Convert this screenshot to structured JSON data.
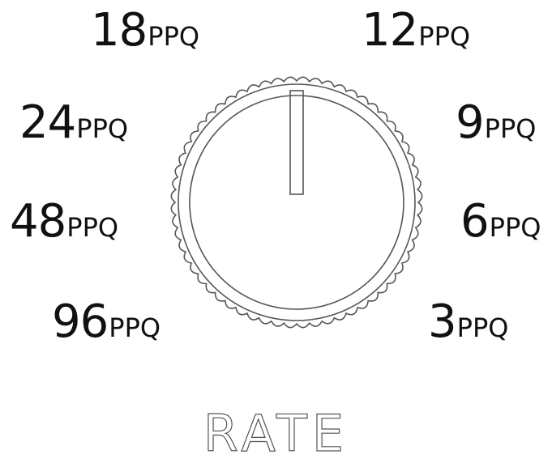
{
  "control": {
    "name": "RATE",
    "selected_index": 0
  },
  "positions": [
    {
      "value": "18",
      "unit": "PPQ"
    },
    {
      "value": "12",
      "unit": "PPQ"
    },
    {
      "value": "24",
      "unit": "PPQ"
    },
    {
      "value": "9",
      "unit": "PPQ"
    },
    {
      "value": "48",
      "unit": "PPQ"
    },
    {
      "value": "6",
      "unit": "PPQ"
    },
    {
      "value": "96",
      "unit": "PPQ"
    },
    {
      "value": "3",
      "unit": "PPQ"
    }
  ],
  "colors": {
    "stroke": "#555555",
    "text": "#111111",
    "background": "#ffffff"
  }
}
